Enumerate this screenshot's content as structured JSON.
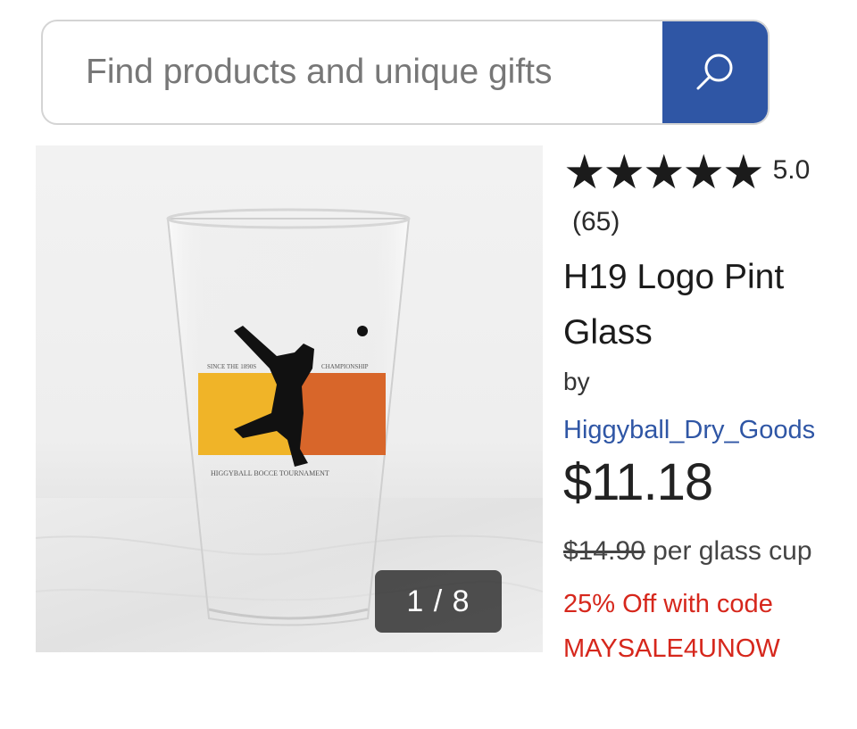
{
  "search": {
    "placeholder": "Find products and unique gifts",
    "button_icon": "search-icon",
    "button_color": "#2f56a5"
  },
  "gallery": {
    "counter": "1 / 8",
    "image_description_icon": "product-photo",
    "logo_colors": [
      "#f0b428",
      "#d8662a",
      "#111111"
    ]
  },
  "product": {
    "stars": "★★★★★",
    "rating": "5.0",
    "review_count": "(65)",
    "title": "H19 Logo Pint Glass",
    "by_label": "by",
    "seller": "Higgyball_Dry_Goods",
    "price": "$11.18",
    "original_price": "$14.90",
    "unit": "per glass cup",
    "promo": "25% Off with code MAYSALE4UNOW",
    "colors": {
      "link": "#2f56a5",
      "promo": "#d6271c"
    }
  }
}
